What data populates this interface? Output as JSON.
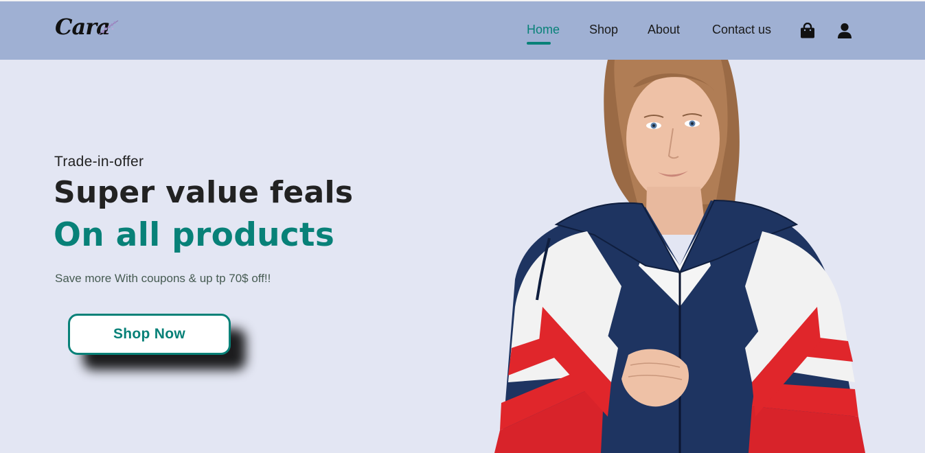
{
  "header": {
    "logo_text": "Cara",
    "nav": [
      {
        "label": "Home",
        "active": true
      },
      {
        "label": "Shop",
        "active": false
      },
      {
        "label": "About",
        "active": false
      },
      {
        "label": "Contact us",
        "active": false
      }
    ],
    "icons": [
      "shopping-bag-icon",
      "user-icon"
    ]
  },
  "hero": {
    "kicker": "Trade-in-offer",
    "headline": "Super value feals",
    "headline_accent": "On all products",
    "subtext": "Save more With coupons & up tp 70$ off!!",
    "cta_label": "Shop Now",
    "image": "model-in-red-white-navy-windbreaker"
  },
  "colors": {
    "header_bg": "#9fb0d3",
    "page_bg": "#e3e6f3",
    "accent": "#088178",
    "text": "#222222"
  }
}
